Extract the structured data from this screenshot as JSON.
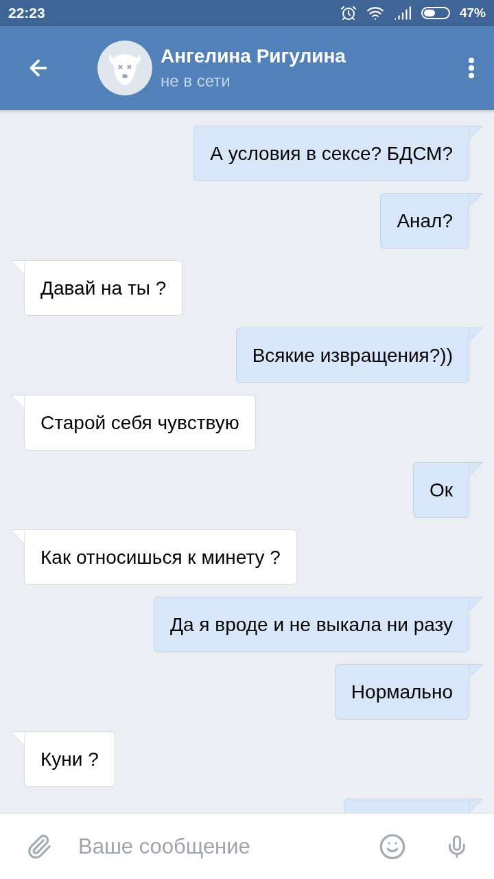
{
  "status_bar": {
    "time": "22:23",
    "battery": "47%"
  },
  "header": {
    "name": "Ангелина Ригулина",
    "status": "не в сети"
  },
  "messages": [
    {
      "kind": "sent",
      "text": "А условия в сексе? БДСМ?"
    },
    {
      "kind": "sent",
      "text": "Анал?"
    },
    {
      "kind": "received",
      "text": "Давай на ты ?"
    },
    {
      "kind": "sent",
      "text": "Всякие извращения?))"
    },
    {
      "kind": "received",
      "text": "Старой себя чувствую"
    },
    {
      "kind": "sent",
      "text": "Ок"
    },
    {
      "kind": "received",
      "text": "Как относишься к минету ?"
    },
    {
      "kind": "sent",
      "text": "Да я вроде и не выкала ни разу"
    },
    {
      "kind": "sent",
      "text": "Нормально"
    },
    {
      "kind": "received",
      "text": "Куни ?"
    },
    {
      "kind": "covered"
    }
  ],
  "composer": {
    "placeholder": "Ваше сообщение"
  }
}
